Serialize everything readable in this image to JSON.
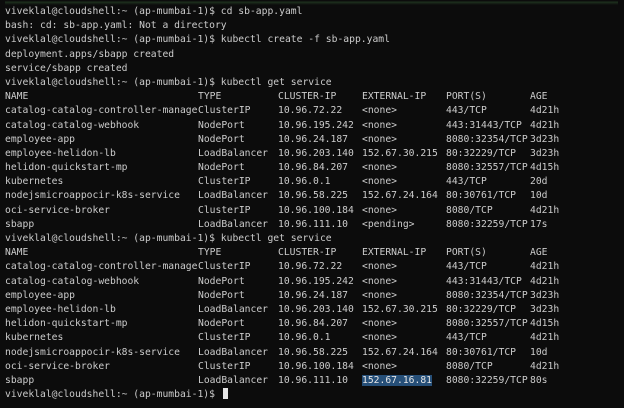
{
  "lines": [
    {
      "kind": "text",
      "text": "viveklal@cloudshell:~ (ap-mumbai-1)$ cd sb-app.yaml"
    },
    {
      "kind": "text",
      "text": "bash: cd: sb-app.yaml: Not a directory"
    },
    {
      "kind": "text",
      "text": "viveklal@cloudshell:~ (ap-mumbai-1)$ kubectl create -f sb-app.yaml"
    },
    {
      "kind": "text",
      "text": "deployment.apps/sbapp created"
    },
    {
      "kind": "text",
      "text": "service/sbapp created"
    },
    {
      "kind": "text",
      "text": "viveklal@cloudshell:~ (ap-mumbai-1)$ kubectl get service"
    },
    {
      "kind": "row",
      "cells": [
        "NAME",
        "TYPE",
        "CLUSTER-IP",
        "EXTERNAL-IP",
        "PORT(S)",
        "AGE"
      ]
    },
    {
      "kind": "row",
      "cells": [
        "catalog-catalog-controller-manager",
        "ClusterIP",
        "10.96.72.22",
        "<none>",
        "443/TCP",
        "4d21h"
      ]
    },
    {
      "kind": "row",
      "cells": [
        "catalog-catalog-webhook",
        "NodePort",
        "10.96.195.242",
        "<none>",
        "443:31443/TCP",
        "4d21h"
      ]
    },
    {
      "kind": "row",
      "cells": [
        "employee-app",
        "NodePort",
        "10.96.24.187",
        "<none>",
        "8080:32354/TCP",
        "3d23h"
      ]
    },
    {
      "kind": "row",
      "cells": [
        "employee-helidon-lb",
        "LoadBalancer",
        "10.96.203.140",
        "152.67.30.215",
        "80:32229/TCP",
        "3d23h"
      ]
    },
    {
      "kind": "row",
      "cells": [
        "helidon-quickstart-mp",
        "NodePort",
        "10.96.84.207",
        "<none>",
        "8080:32557/TCP",
        "4d15h"
      ]
    },
    {
      "kind": "row",
      "cells": [
        "kubernetes",
        "ClusterIP",
        "10.96.0.1",
        "<none>",
        "443/TCP",
        "20d"
      ]
    },
    {
      "kind": "row",
      "cells": [
        "nodejsmicroappocir-k8s-service",
        "LoadBalancer",
        "10.96.58.225",
        "152.67.24.164",
        "80:30761/TCP",
        "10d"
      ]
    },
    {
      "kind": "row",
      "cells": [
        "oci-service-broker",
        "ClusterIP",
        "10.96.100.184",
        "<none>",
        "8080/TCP",
        "4d21h"
      ]
    },
    {
      "kind": "row",
      "cells": [
        "sbapp",
        "LoadBalancer",
        "10.96.111.10",
        "<pending>",
        "8080:32259/TCP",
        "17s"
      ]
    },
    {
      "kind": "text",
      "text": "viveklal@cloudshell:~ (ap-mumbai-1)$ kubectl get service"
    },
    {
      "kind": "row",
      "cells": [
        "NAME",
        "TYPE",
        "CLUSTER-IP",
        "EXTERNAL-IP",
        "PORT(S)",
        "AGE"
      ]
    },
    {
      "kind": "row",
      "cells": [
        "catalog-catalog-controller-manager",
        "ClusterIP",
        "10.96.72.22",
        "<none>",
        "443/TCP",
        "4d21h"
      ]
    },
    {
      "kind": "row",
      "cells": [
        "catalog-catalog-webhook",
        "NodePort",
        "10.96.195.242",
        "<none>",
        "443:31443/TCP",
        "4d21h"
      ]
    },
    {
      "kind": "row",
      "cells": [
        "employee-app",
        "NodePort",
        "10.96.24.187",
        "<none>",
        "8080:32354/TCP",
        "3d23h"
      ]
    },
    {
      "kind": "row",
      "cells": [
        "employee-helidon-lb",
        "LoadBalancer",
        "10.96.203.140",
        "152.67.30.215",
        "80:32229/TCP",
        "3d23h"
      ]
    },
    {
      "kind": "row",
      "cells": [
        "helidon-quickstart-mp",
        "NodePort",
        "10.96.84.207",
        "<none>",
        "8080:32557/TCP",
        "4d15h"
      ]
    },
    {
      "kind": "row",
      "cells": [
        "kubernetes",
        "ClusterIP",
        "10.96.0.1",
        "<none>",
        "443/TCP",
        "4d21h"
      ]
    },
    {
      "kind": "row",
      "cells": [
        "nodejsmicroappocir-k8s-service",
        "LoadBalancer",
        "10.96.58.225",
        "152.67.24.164",
        "80:30761/TCP",
        "10d"
      ]
    },
    {
      "kind": "row",
      "cells": [
        "oci-service-broker",
        "ClusterIP",
        "10.96.100.184",
        "<none>",
        "8080/TCP",
        "4d21h"
      ]
    },
    {
      "kind": "row",
      "cells": [
        "sbapp",
        "LoadBalancer",
        "10.96.111.10",
        "152.67.16.81",
        "8080:32259/TCP",
        "80s"
      ],
      "highlight_col": 3
    },
    {
      "kind": "prompt",
      "text": "viveklal@cloudshell:~ (ap-mumbai-1)$ "
    }
  ],
  "colors": {
    "background": "#0c0c0c",
    "text": "#cccccc",
    "selection": "#264f78",
    "cursor": "#e6e6e6"
  }
}
